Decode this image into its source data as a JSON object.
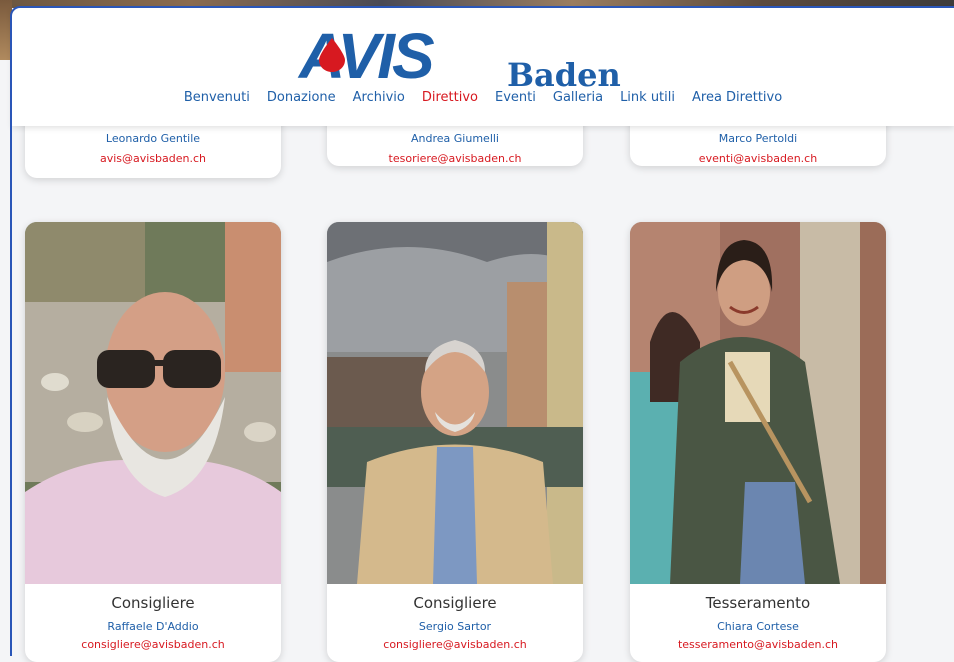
{
  "brand": {
    "logo_text": "AVIS",
    "logo_subtitle": "Baden",
    "primary_color": "#1f5fa8",
    "accent_color": "#d71920"
  },
  "nav": {
    "items": [
      {
        "label": "Benvenuti"
      },
      {
        "label": "Donazione"
      },
      {
        "label": "Archivio"
      },
      {
        "label": "Direttivo",
        "active": true
      },
      {
        "label": "Eventi"
      },
      {
        "label": "Galleria"
      },
      {
        "label": "Link utili"
      },
      {
        "label": "Area Direttivo"
      }
    ]
  },
  "top_cards": [
    {
      "name": "Leonardo Gentile",
      "email": "avis@avisbaden.ch"
    },
    {
      "name": "Andrea Giumelli",
      "email": "tesoriere@avisbaden.ch"
    },
    {
      "name": "Marco Pertoldi",
      "email": "eventi@avisbaden.ch"
    }
  ],
  "members": [
    {
      "role": "Consigliere",
      "name": "Raffaele D'Addio",
      "email": "consigliere@avisbaden.ch",
      "photo_icon": "portrait-photo"
    },
    {
      "role": "Consigliere",
      "name": "Sergio Sartor",
      "email": "consigliere@avisbaden.ch",
      "photo_icon": "portrait-photo"
    },
    {
      "role": "Tesseramento",
      "name": "Chiara Cortese",
      "email": "tesseramento@avisbaden.ch",
      "photo_icon": "portrait-photo"
    }
  ]
}
